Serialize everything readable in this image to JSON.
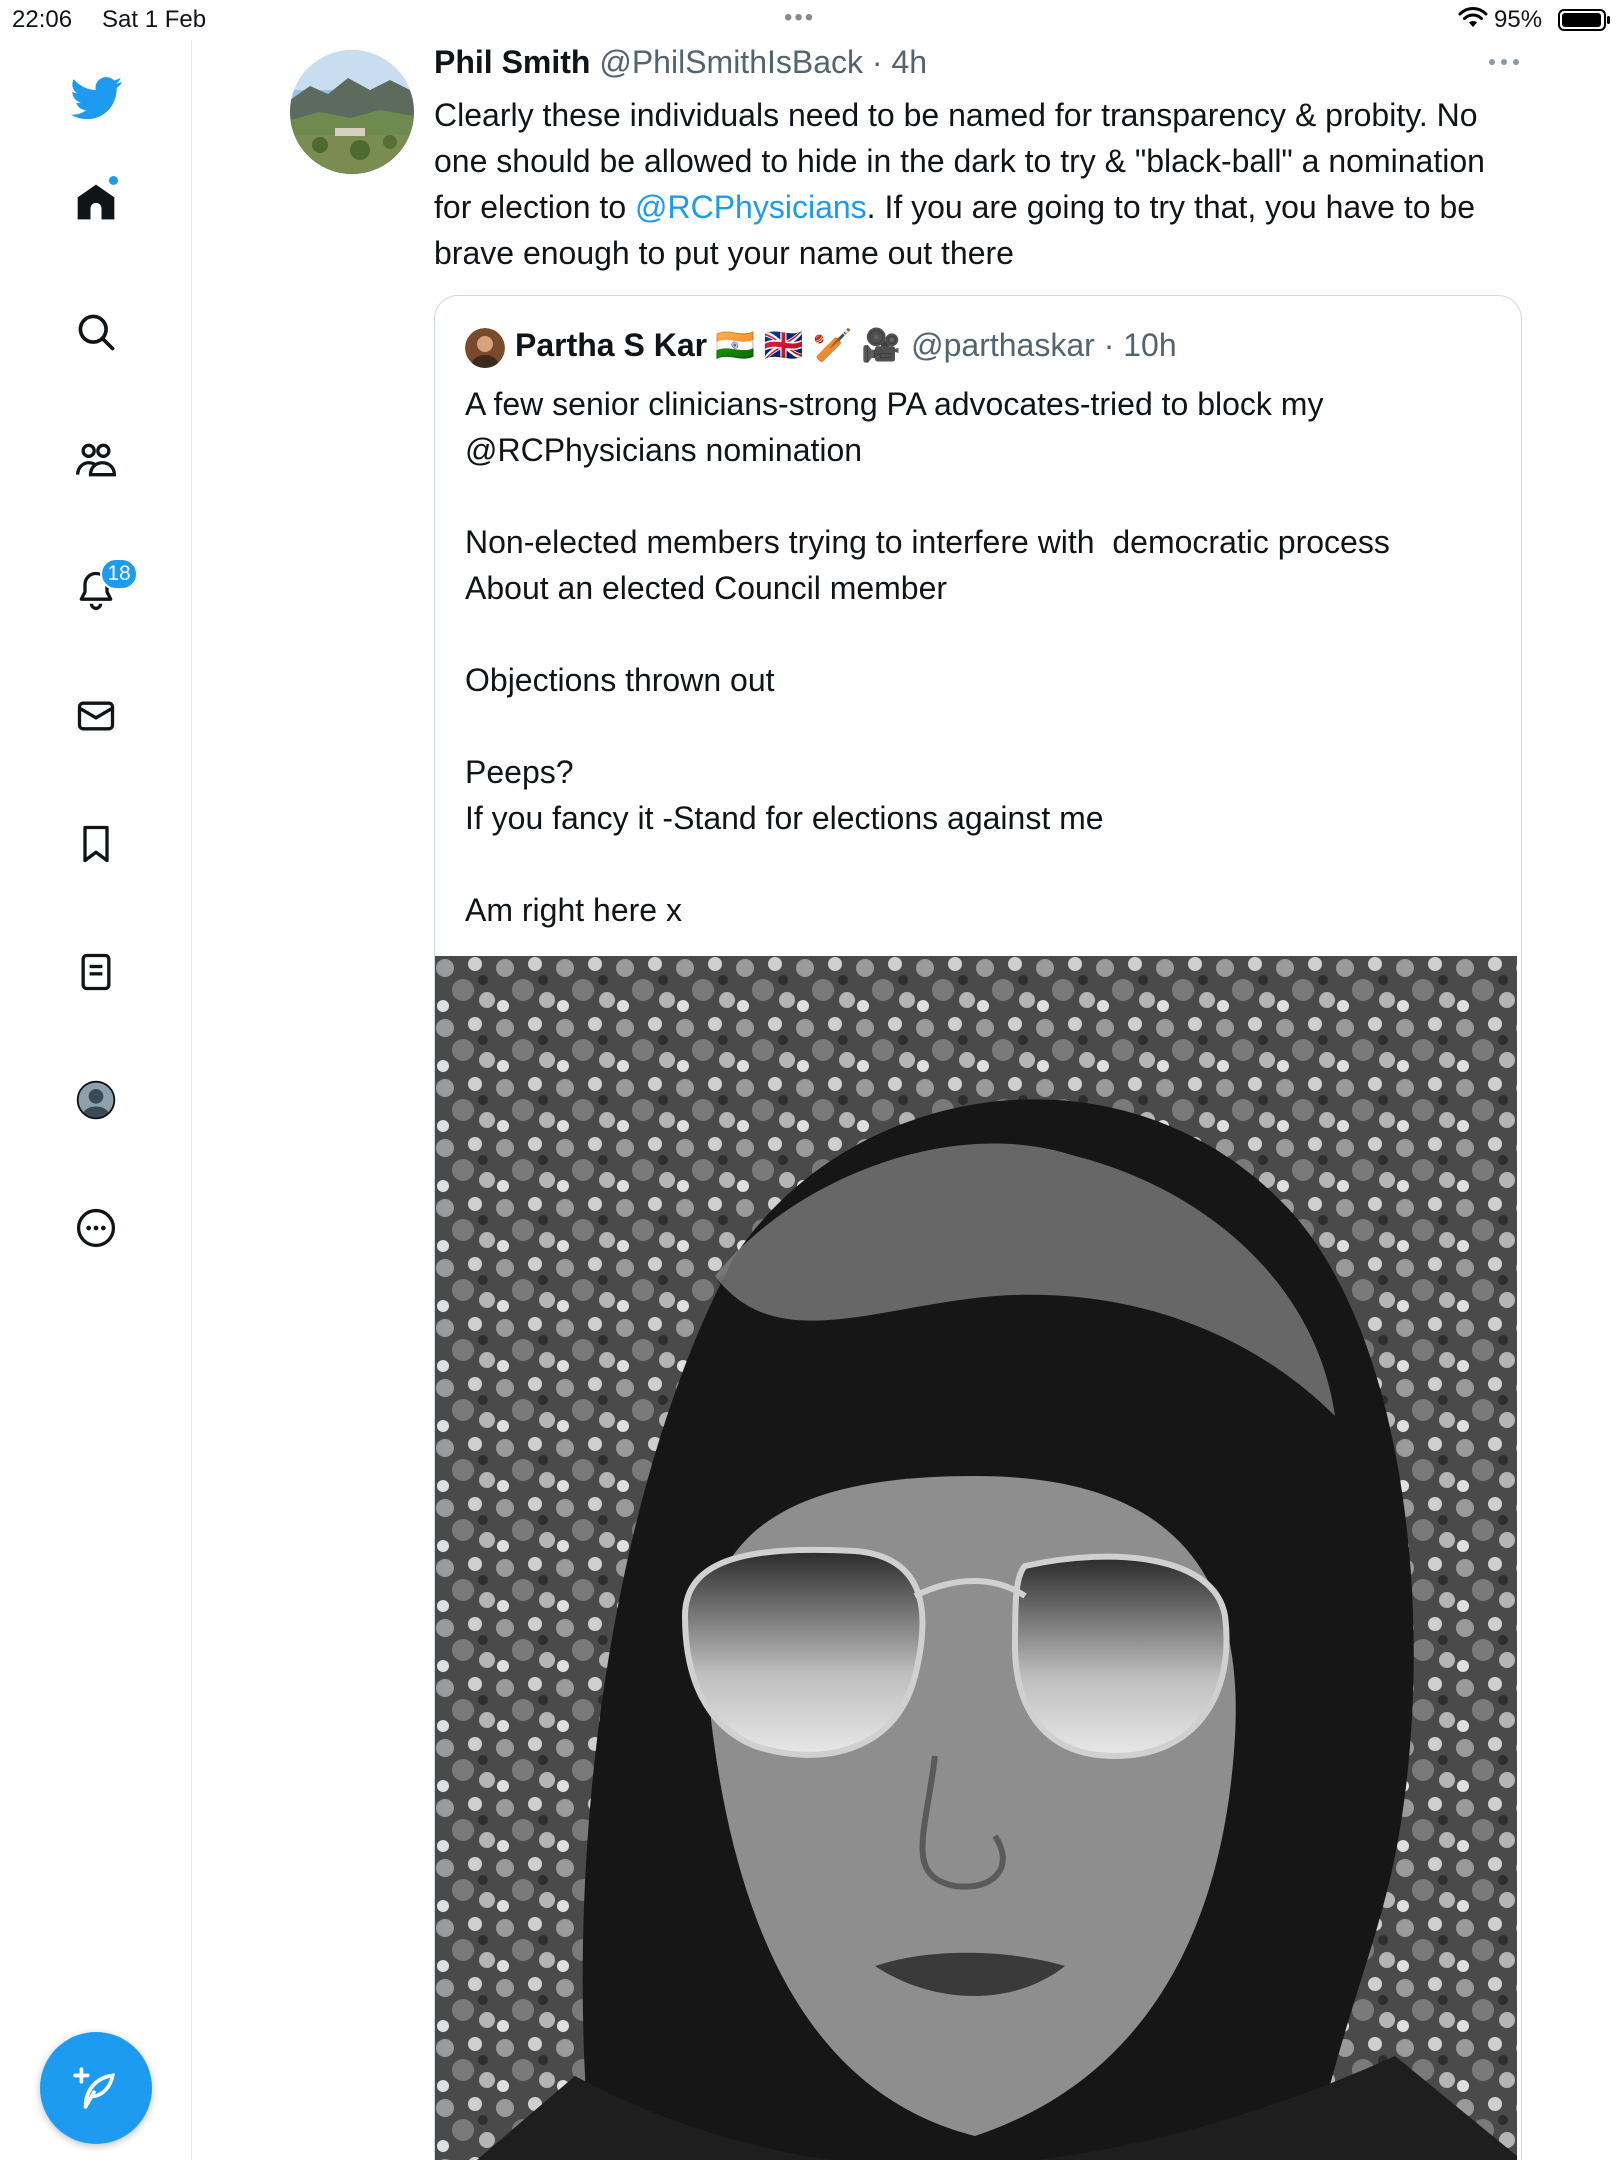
{
  "status_bar": {
    "time": "22:06",
    "date": "Sat 1 Feb",
    "battery": "95%"
  },
  "sidebar": {
    "notifications_badge": "18",
    "items": [
      {
        "name": "home",
        "icon": "home-icon"
      },
      {
        "name": "explore",
        "icon": "search-icon"
      },
      {
        "name": "communities",
        "icon": "communities-icon"
      },
      {
        "name": "notifications",
        "icon": "bell-icon"
      },
      {
        "name": "messages",
        "icon": "envelope-icon"
      },
      {
        "name": "bookmarks",
        "icon": "bookmark-icon"
      },
      {
        "name": "lists",
        "icon": "list-icon"
      },
      {
        "name": "profile",
        "icon": "profile-icon"
      },
      {
        "name": "more",
        "icon": "more-circle-icon"
      }
    ],
    "compose_icon": "compose-feather-icon"
  },
  "tweet": {
    "author_name": "Phil Smith",
    "author_handle": "@PhilSmithIsBack",
    "time": "4h",
    "text_part1": "Clearly these individuals need to be named for transparency & probity. No one should be allowed to hide in the dark to try & \"black-ball\" a nomination for election to ",
    "mention": "@RCPhysicians",
    "text_part2": ". If you are going to try that, you have to be brave enough to put your name out there"
  },
  "quoted_tweet": {
    "author_name": "Partha S Kar",
    "emojis": "🇮🇳 🇬🇧 🏏 🎥",
    "author_handle": "@parthaskar",
    "time": "10h",
    "text": "A few senior clinicians-strong PA advocates-tried to block my\n@RCPhysicians nomination\n\nNon-elected members trying to interfere with  democratic process\nAbout an elected Council member\n\nObjections thrown out\n\nPeeps?\nIf you fancy it -Stand for elections against me\n\nAm right here x"
  },
  "colors": {
    "accent": "#1d9bf0",
    "text": "#0f1419",
    "secondary_text": "#536471",
    "border": "#cfd9de"
  }
}
